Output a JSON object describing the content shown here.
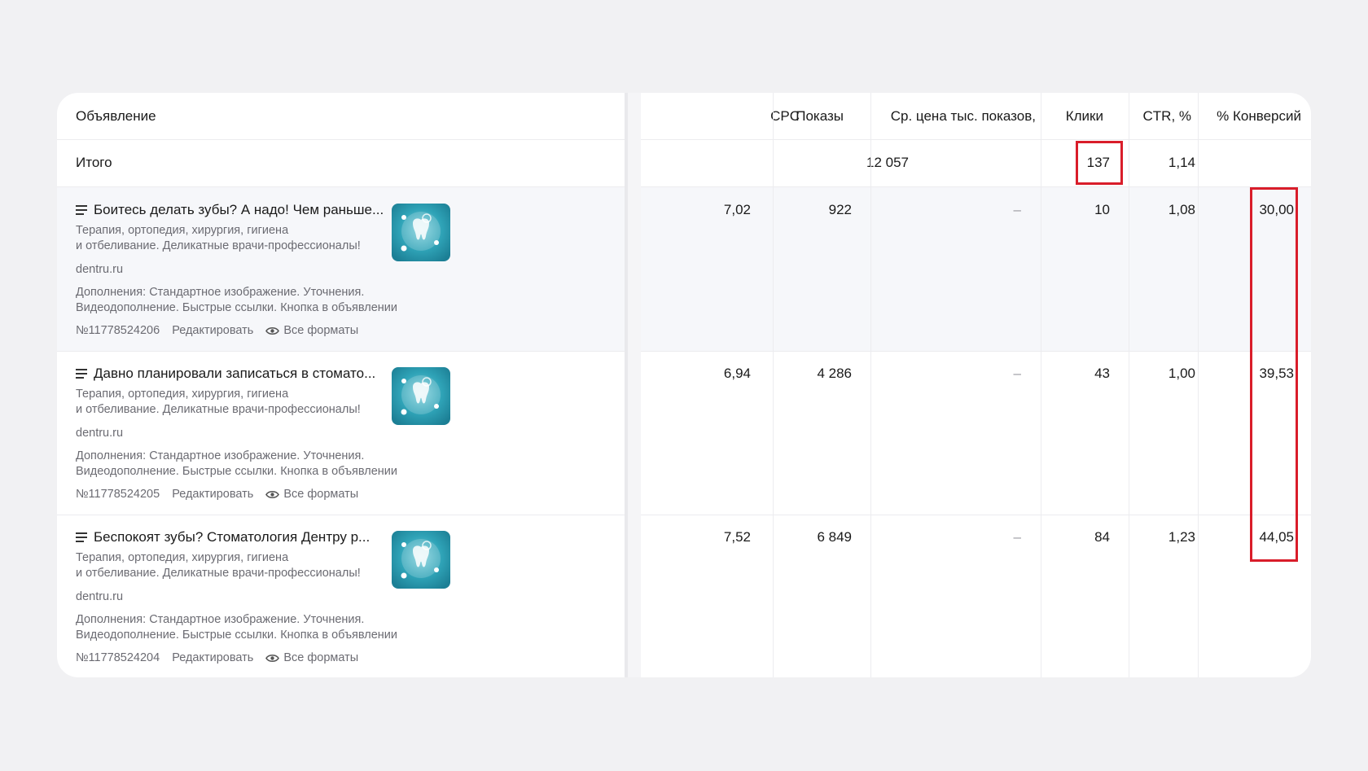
{
  "columns": {
    "ad": "Объявление",
    "cpc": "CPC",
    "impressions": "Показы",
    "cpm": "Ср. цена тыс. показов,",
    "clicks": "Клики",
    "ctr": "CTR, %",
    "conv": "% Конверсий"
  },
  "total": {
    "label": "Итого",
    "impressions": "12 057",
    "clicks": "137",
    "ctr": "1,14"
  },
  "ads": [
    {
      "title": "Боитесь делать зубы? А надо! Чем раньше...",
      "text1": "Терапия, ортопедия, хирургия, гигиена",
      "text2": "и отбеливание. Деликатные врачи-профессионалы!",
      "domain": "dentru.ru",
      "extras1": "Дополнения: Стандартное изображение. Уточнения.",
      "extras2": "Видеодополнение. Быстрые ссылки. Кнопка в объявлении",
      "id": "№11778524206",
      "edit": "Редактировать",
      "formats": "Все форматы",
      "cpc": "7,02",
      "impressions": "922",
      "cpm": "–",
      "clicks": "10",
      "ctr": "1,08",
      "conv": "30,00"
    },
    {
      "title": "Давно планировали записаться в стомато...",
      "text1": "Терапия, ортопедия, хирургия, гигиена",
      "text2": "и отбеливание. Деликатные врачи-профессионалы!",
      "domain": "dentru.ru",
      "extras1": "Дополнения: Стандартное изображение. Уточнения.",
      "extras2": "Видеодополнение. Быстрые ссылки. Кнопка в объявлении",
      "id": "№11778524205",
      "edit": "Редактировать",
      "formats": "Все форматы",
      "cpc": "6,94",
      "impressions": "4 286",
      "cpm": "–",
      "clicks": "43",
      "ctr": "1,00",
      "conv": "39,53"
    },
    {
      "title": "Беспокоят зубы? Стоматология Дентру р...",
      "text1": "Терапия, ортопедия, хирургия, гигиена",
      "text2": "и отбеливание. Деликатные врачи-профессионалы!",
      "domain": "dentru.ru",
      "extras1": "Дополнения: Стандартное изображение. Уточнения.",
      "extras2": "Видеодополнение. Быстрые ссылки. Кнопка в объявлении",
      "id": "№11778524204",
      "edit": "Редактировать",
      "formats": "Все форматы",
      "cpc": "7,52",
      "impressions": "6 849",
      "cpm": "–",
      "clicks": "84",
      "ctr": "1,23",
      "conv": "44,05"
    }
  ],
  "colors": {
    "highlight": "#d91d2a",
    "thumb": "#2a9bb0"
  },
  "icons": {
    "ad_type": "text-ad-icon",
    "thumb": "tooth-image",
    "formats": "eye-icon"
  }
}
